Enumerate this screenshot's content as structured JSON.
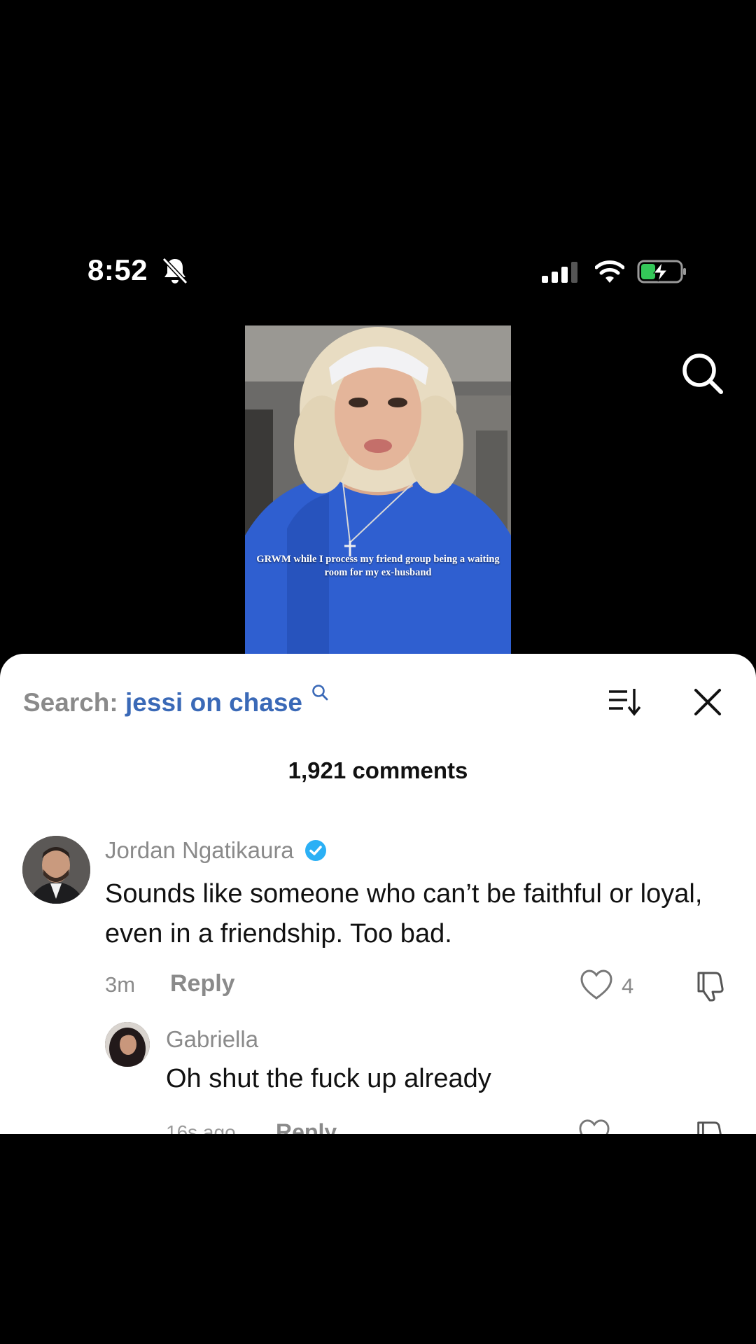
{
  "status_bar": {
    "time": "8:52"
  },
  "video": {
    "caption": "GRWM while I process my friend group being a waiting room for my ex-husband"
  },
  "comments_sheet": {
    "search_prefix": "Search:",
    "search_query": "jessi on chase",
    "comment_count": "1,921 comments",
    "comments": [
      {
        "username": "Jordan Ngatikaura",
        "verified": true,
        "text": "Sounds like someone who can’t be faithful or loyal, even in a friendship. Too bad.",
        "time": "3m",
        "reply_label": "Reply",
        "likes": "4"
      },
      {
        "username": "Gabriella",
        "text": "Oh shut the fuck up already",
        "time": "16s ago",
        "reply_label": "Reply"
      }
    ]
  },
  "colors": {
    "search_query": "#3a69b7",
    "verified_badge": "#2bb0f5",
    "battery_charge": "#34c759"
  }
}
